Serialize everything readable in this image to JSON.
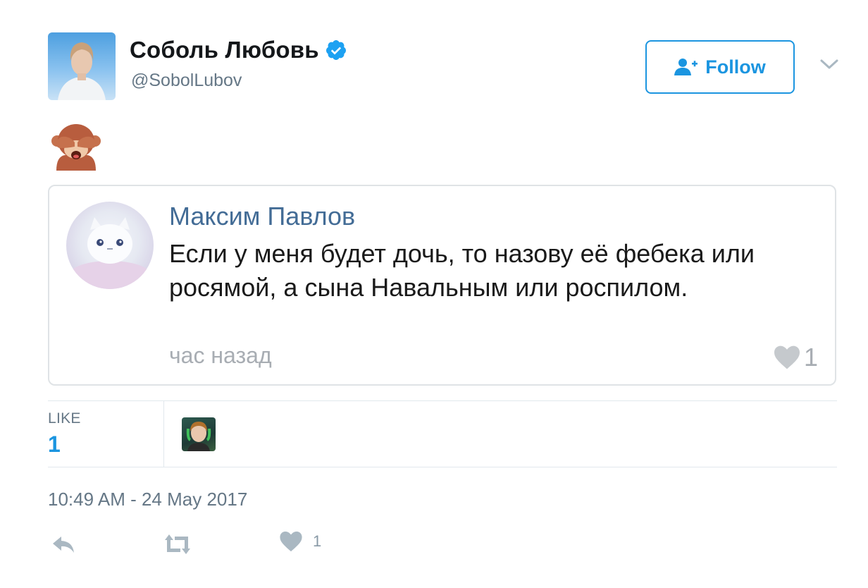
{
  "tweet": {
    "author": {
      "display_name": "Соболь Любовь",
      "handle": "@SobolLubov",
      "verified": true
    },
    "follow_button_label": "Follow",
    "body_emoji": "see-no-evil-monkey",
    "timestamp": "10:49 AM - 24 May 2017"
  },
  "quoted_card": {
    "author": "Максим Павлов",
    "text": "Если у меня будет дочь, то назову её фебека или росямой, а сына Навальным или роспилом.",
    "time": "час назад",
    "likes": "1"
  },
  "stats": {
    "like_label": "LIKE",
    "like_count": "1"
  },
  "actions": {
    "like_count": "1"
  },
  "icons": {
    "verified": "verified-badge-icon",
    "follow": "add-user-icon",
    "menu": "chevron-down-icon",
    "reply": "reply-icon",
    "retweet": "retweet-icon",
    "like": "heart-icon"
  },
  "colors": {
    "accent": "#1b95e0",
    "muted": "#657786",
    "vk_link": "#436c96"
  }
}
